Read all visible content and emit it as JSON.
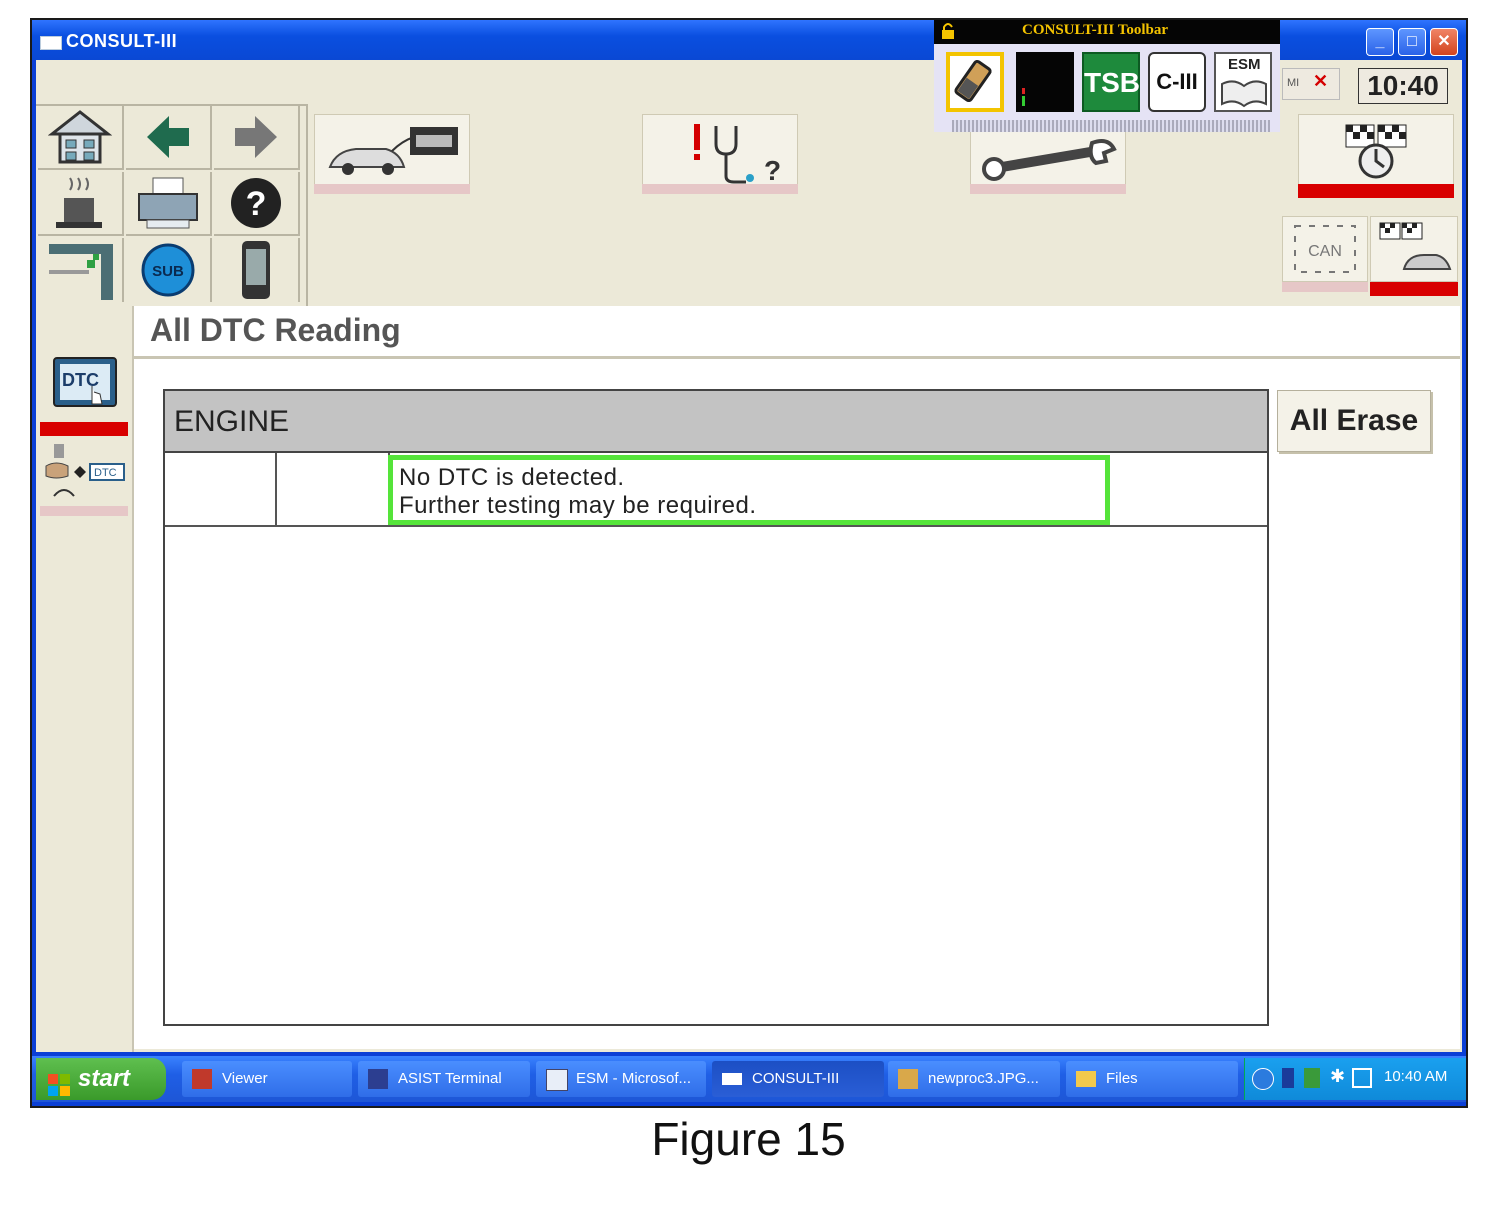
{
  "window": {
    "title": "CONSULT-III",
    "minimize_icon": "minimize-icon",
    "maximize_icon": "maximize-icon",
    "close_icon": "close-icon"
  },
  "toolbar_popup": {
    "title": "CONSULT-III Toolbar",
    "buttons": [
      {
        "icon": "battery-icon"
      },
      {
        "icon": "signal-meter-icon"
      },
      {
        "label": "TSB",
        "icon": "tsb-icon"
      },
      {
        "label": "C-III",
        "icon": "c3-icon"
      },
      {
        "label": "ESM",
        "icon": "esm-book-icon"
      }
    ]
  },
  "clock": "10:40",
  "status_indicator": "MI",
  "main_toolbar": {
    "left_grid_icons": [
      "home-icon",
      "back-arrow-icon",
      "forward-arrow-icon",
      "coffee-icon",
      "printer-icon",
      "help-icon",
      "flag-step-icon",
      "sub-icon",
      "phone-icon"
    ],
    "sub_label": "SUB",
    "big_buttons": [
      "vehicle-scan-icon",
      "diagnosis-stethoscope-icon",
      "wrench-icon",
      "race-flags-icon"
    ],
    "can_label": "CAN"
  },
  "sidebar": {
    "dtc_label": "DTC",
    "dtc_small_label": "DTC"
  },
  "page": {
    "title": "All DTC Reading",
    "system_header": "ENGINE",
    "message_line1": "No DTC is detected.",
    "message_line2": "Further testing may be required.",
    "all_erase_label": "All Erase"
  },
  "colors": {
    "highlight_border": "#55e43a",
    "accent_red": "#d80000",
    "window_blue": "#0b3fd6"
  },
  "taskbar": {
    "start_label": "start",
    "tasks": [
      "Viewer",
      "ASIST Terminal",
      "ESM - Microsof...",
      "CONSULT-III",
      "newproc3.JPG...",
      "Files"
    ],
    "time": "10:40 AM"
  },
  "caption": "Figure 15"
}
